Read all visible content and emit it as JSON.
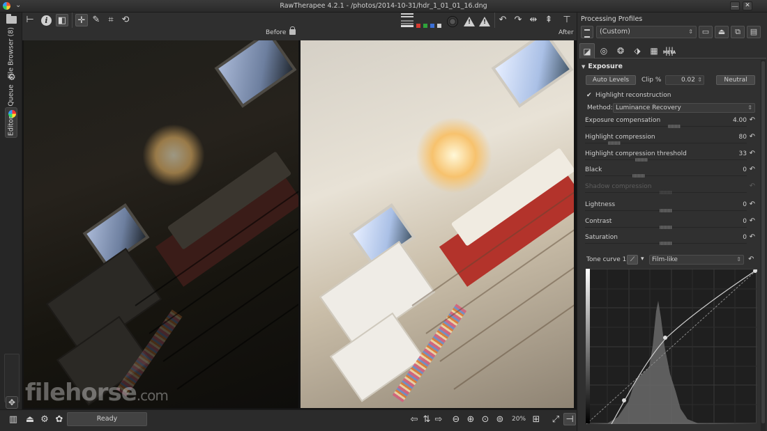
{
  "window": {
    "title": "RawTherapee 4.2.1 - /photos/2014-10-31/hdr_1_01_01_16.dng",
    "controls": [
      "⎼",
      "✕"
    ]
  },
  "left_tabs": {
    "file_browser": "File Browser (8)",
    "queue": "Queue",
    "editor": "Editor"
  },
  "viewer": {
    "before_label": "Before",
    "after_label": "After"
  },
  "watermark": {
    "text": "filehorse",
    "suffix": ".com"
  },
  "bottom": {
    "status": "Ready",
    "zoom": "20%"
  },
  "profiles": {
    "title": "Processing Profiles",
    "current": "(Custom)"
  },
  "exposure": {
    "header": "Exposure",
    "auto_levels": "Auto Levels",
    "clip_label": "Clip %",
    "clip_value": "0.02",
    "neutral": "Neutral",
    "highlight_reconstruction": "Highlight reconstruction",
    "method_label": "Method:",
    "method_value": "Luminance Recovery",
    "sliders": [
      {
        "name": "Exposure compensation",
        "value": "4.00",
        "pos": 0.55
      },
      {
        "name": "Highlight compression",
        "value": "80",
        "pos": 0.18
      },
      {
        "name": "Highlight compression threshold",
        "value": "33",
        "pos": 0.35
      },
      {
        "name": "Black",
        "value": "0",
        "pos": 0.33
      },
      {
        "name": "Shadow compression",
        "value": "",
        "pos": 0.5,
        "disabled": true
      },
      {
        "name": "Lightness",
        "value": "0",
        "pos": 0.5
      },
      {
        "name": "Contrast",
        "value": "0",
        "pos": 0.5
      },
      {
        "name": "Saturation",
        "value": "0",
        "pos": 0.5
      }
    ],
    "tone_curve_label": "Tone curve 1:",
    "tone_curve_mode": "Film-like"
  },
  "colors": {
    "accent_red": "#d63a2f",
    "accent_green": "#2fa33a",
    "accent_blue": "#3a6fd6"
  }
}
